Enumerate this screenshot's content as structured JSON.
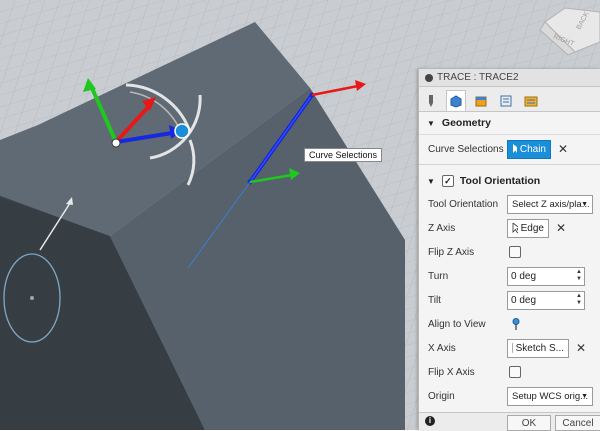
{
  "tooltip": "Curve Selections",
  "viewcube": {
    "faces": [
      "RIGHT",
      "BACK"
    ]
  },
  "panel": {
    "title": "TRACE : TRACE2",
    "tab_icons": [
      "tool-icon",
      "shape-icon",
      "heights-icon",
      "passes-icon",
      "linking-icon"
    ],
    "geometry": {
      "header": "Geometry",
      "curve_selections_label": "Curve Selections",
      "chain_label": "Chain"
    },
    "tool_orientation": {
      "header": "Tool Orientation",
      "checked": true,
      "orientation_label": "Tool Orientation",
      "orientation_value": "Select Z axis/pla...",
      "z_axis_label": "Z Axis",
      "z_axis_value": "Edge",
      "flip_z_label": "Flip Z Axis",
      "turn_label": "Turn",
      "turn_value": "0 deg",
      "tilt_label": "Tilt",
      "tilt_value": "0 deg",
      "align_label": "Align to View",
      "x_axis_label": "X Axis",
      "x_axis_value": "Sketch S...",
      "flip_x_label": "Flip X Axis",
      "origin_label": "Origin",
      "origin_value": "Setup WCS orig..."
    },
    "footer": {
      "ok": "OK",
      "cancel": "Cancel"
    }
  },
  "colors": {
    "accent": "#1a8ed8",
    "x_axis": "#e81818",
    "y_axis": "#1ec81e",
    "z_axis": "#1628e0",
    "edge": "#1a24d8"
  }
}
